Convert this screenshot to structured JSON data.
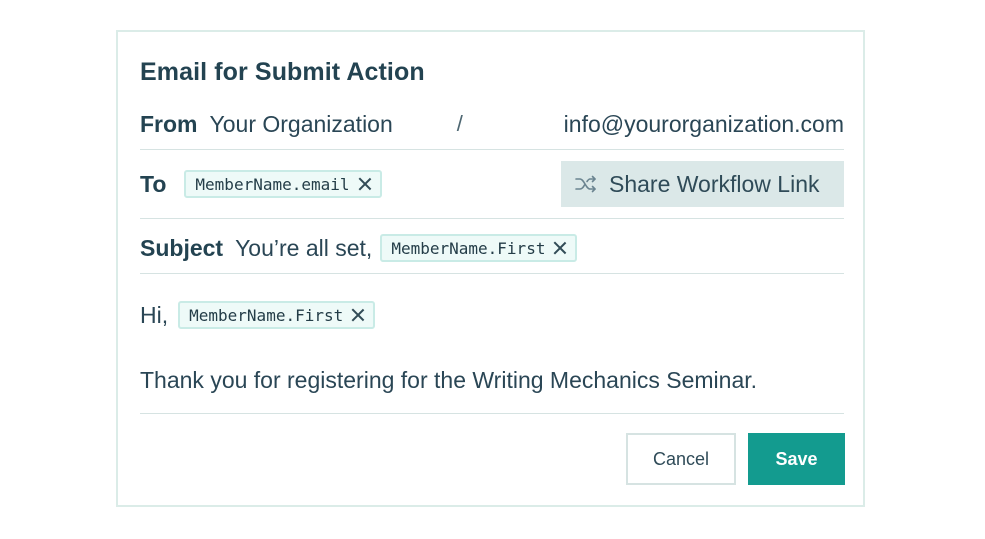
{
  "dialog": {
    "title": "Email for Submit Action"
  },
  "from": {
    "label": "From",
    "name": "Your Organization",
    "separator": "/",
    "email": "info@yourorganization.com"
  },
  "to": {
    "label": "To",
    "chip": "MemberName.email",
    "share_button": "Share Workflow Link",
    "share_icon": "shuffle-icon"
  },
  "subject": {
    "label": "Subject",
    "text": "You’re all set,",
    "chip": "MemberName.First"
  },
  "body": {
    "greeting": "Hi,",
    "greeting_chip": "MemberName.First",
    "message": "Thank you for registering for the Writing Mechanics Seminar."
  },
  "actions": {
    "cancel_label": "Cancel",
    "save_label": "Save"
  },
  "colors": {
    "accent": "#139b8f",
    "chip_border": "#c9ebe6",
    "chip_bg": "#eefaf8",
    "share_bg": "#dbe8e8",
    "text": "#234351"
  }
}
